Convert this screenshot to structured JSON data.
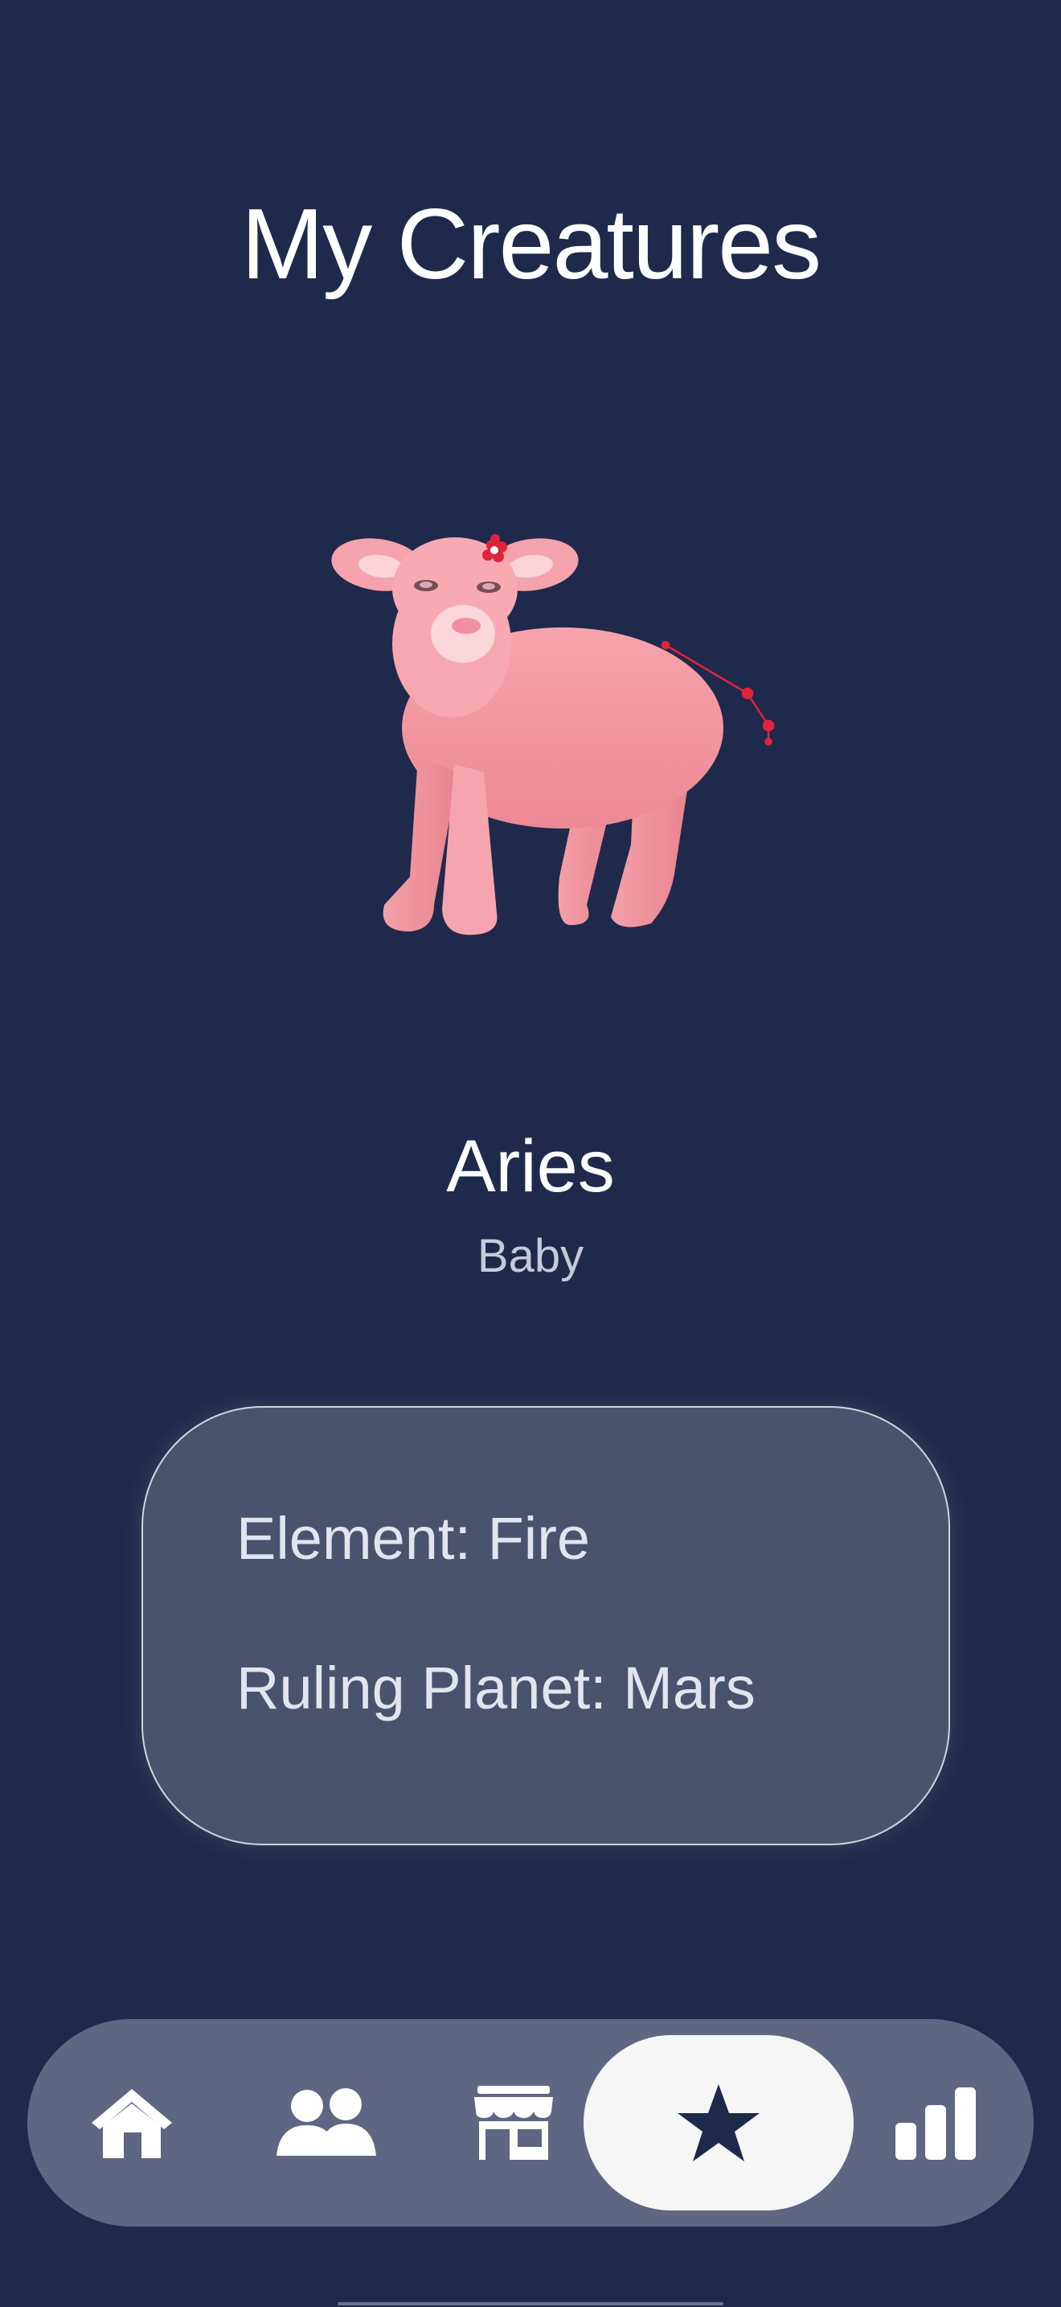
{
  "header": {
    "title": "My Creatures"
  },
  "creature": {
    "name": "Aries",
    "stage": "Baby",
    "illustration": "pink-lamb-with-constellation"
  },
  "info_card": {
    "element": "Element: Fire",
    "ruling_planet": "Ruling Planet: Mars"
  },
  "tab_bar": {
    "tabs": [
      {
        "icon": "home-icon",
        "active": false
      },
      {
        "icon": "friends-icon",
        "active": false
      },
      {
        "icon": "shop-icon",
        "active": false
      },
      {
        "icon": "star-icon",
        "active": true
      },
      {
        "icon": "stats-icon",
        "active": false
      }
    ]
  },
  "colors": {
    "background": "#1f294b",
    "card": "#4a536e",
    "tab_bar": "#5f6683",
    "active_tab": "#f6f6f7",
    "creature_pink": "#f29aa3",
    "constellation_red": "#e0233a"
  }
}
